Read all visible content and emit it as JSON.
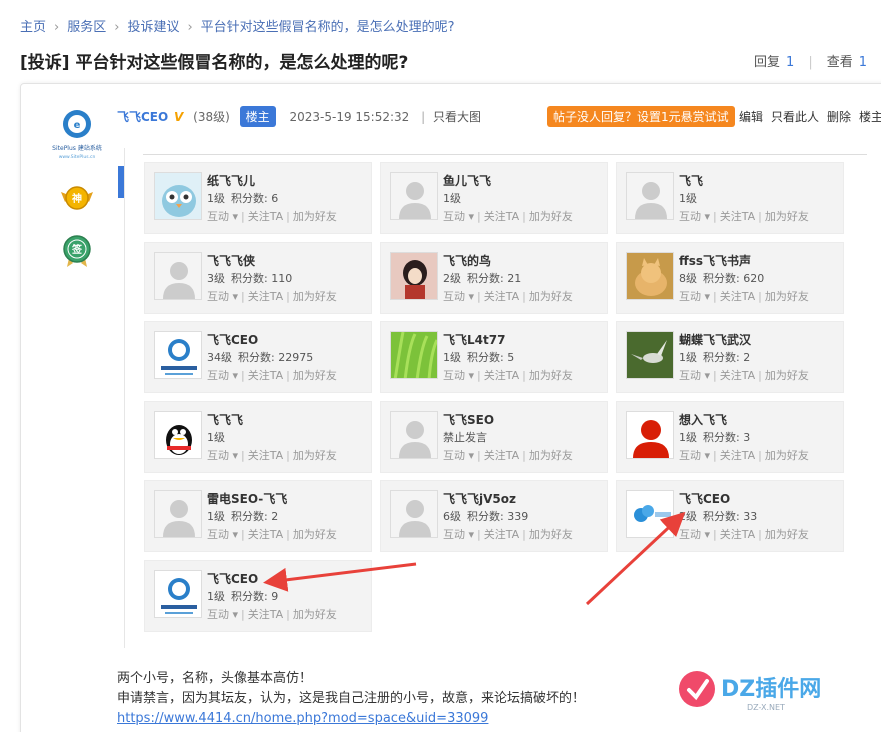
{
  "breadcrumb": [
    "主页",
    "服务区",
    "投诉建议",
    "平台针对这些假冒名称的，是怎么处理的呢?"
  ],
  "thread": {
    "title": "[投诉] 平台针对这些假冒名称的，是怎么处理的呢?",
    "reply_label": "回复",
    "reply_count": "1",
    "view_label": "查看",
    "view_count": "1"
  },
  "post": {
    "author": "飞飞CEO",
    "vip": "V",
    "level": "(38级)",
    "owner_badge": "楼主",
    "time": "2023-5-19 15:52:32",
    "separator": "|",
    "view_big": "只看大图",
    "promo": "帖子没人回复？设置1元悬赏试试",
    "actions": [
      "编辑",
      "只看此人",
      "删除",
      "楼主"
    ],
    "logo_title": "SitePlus 建站系统",
    "logo_url": "www.SitePlus.cn",
    "medal_god": "神",
    "medal_sign": "签"
  },
  "friend_ops": [
    "互动",
    "关注TA",
    "加为好友"
  ],
  "friends": [
    {
      "name": "纸飞飞儿",
      "level": "1级",
      "score": "积分数: 6",
      "avatar": "owl"
    },
    {
      "name": "鱼儿飞飞",
      "level": "1级",
      "score": "",
      "avatar": "default"
    },
    {
      "name": "飞飞",
      "level": "1级",
      "score": "",
      "avatar": "default"
    },
    {
      "name": "飞飞飞侠",
      "level": "3级",
      "score": "积分数: 110",
      "avatar": "default"
    },
    {
      "name": "飞飞的鸟",
      "level": "2级",
      "score": "积分数: 21",
      "avatar": "girl"
    },
    {
      "name": "ffss飞飞书声",
      "level": "8级",
      "score": "积分数: 620",
      "avatar": "cat"
    },
    {
      "name": "飞飞CEO",
      "level": "34级",
      "score": "积分数: 22975",
      "avatar": "siteplus"
    },
    {
      "name": "飞飞L4t77",
      "level": "1级",
      "score": "积分数: 5",
      "avatar": "grass"
    },
    {
      "name": "蝴蝶飞飞武汉",
      "level": "1级",
      "score": "积分数: 2",
      "avatar": "bird"
    },
    {
      "name": "飞飞飞",
      "level": "1级",
      "score": "",
      "avatar": "qq"
    },
    {
      "name": "飞飞SEO",
      "level": "禁止发言",
      "score": "",
      "avatar": "default"
    },
    {
      "name": "想入飞飞",
      "level": "1级",
      "score": "积分数: 3",
      "avatar": "red"
    },
    {
      "name": "雷电SEO-飞飞",
      "level": "1级",
      "score": "积分数: 2",
      "avatar": "default"
    },
    {
      "name": "飞飞飞jV5oz",
      "level": "6级",
      "score": "积分数: 339",
      "avatar": "default"
    },
    {
      "name": "飞飞CEO",
      "level": "2级",
      "score": "积分数: 33",
      "avatar": "cloud"
    },
    {
      "name": "飞飞CEO",
      "level": "1级",
      "score": "积分数: 9",
      "avatar": "siteplus"
    }
  ],
  "content": {
    "line1": "两个小号，名称，头像基本高仿！",
    "line2": "申请禁言，因为其坛友，认为，这是我自己注册的小号，故意，来论坛搞破坏的！",
    "link": "https://www.4414.cn/home.php?mod=space&uid=33099"
  },
  "watermark": {
    "main": "DZ插件网",
    "sub": "DZ-X.NET"
  },
  "colors": {
    "accent": "#3b78d8",
    "promo": "#f5871f",
    "arrow": "#e8413a"
  }
}
